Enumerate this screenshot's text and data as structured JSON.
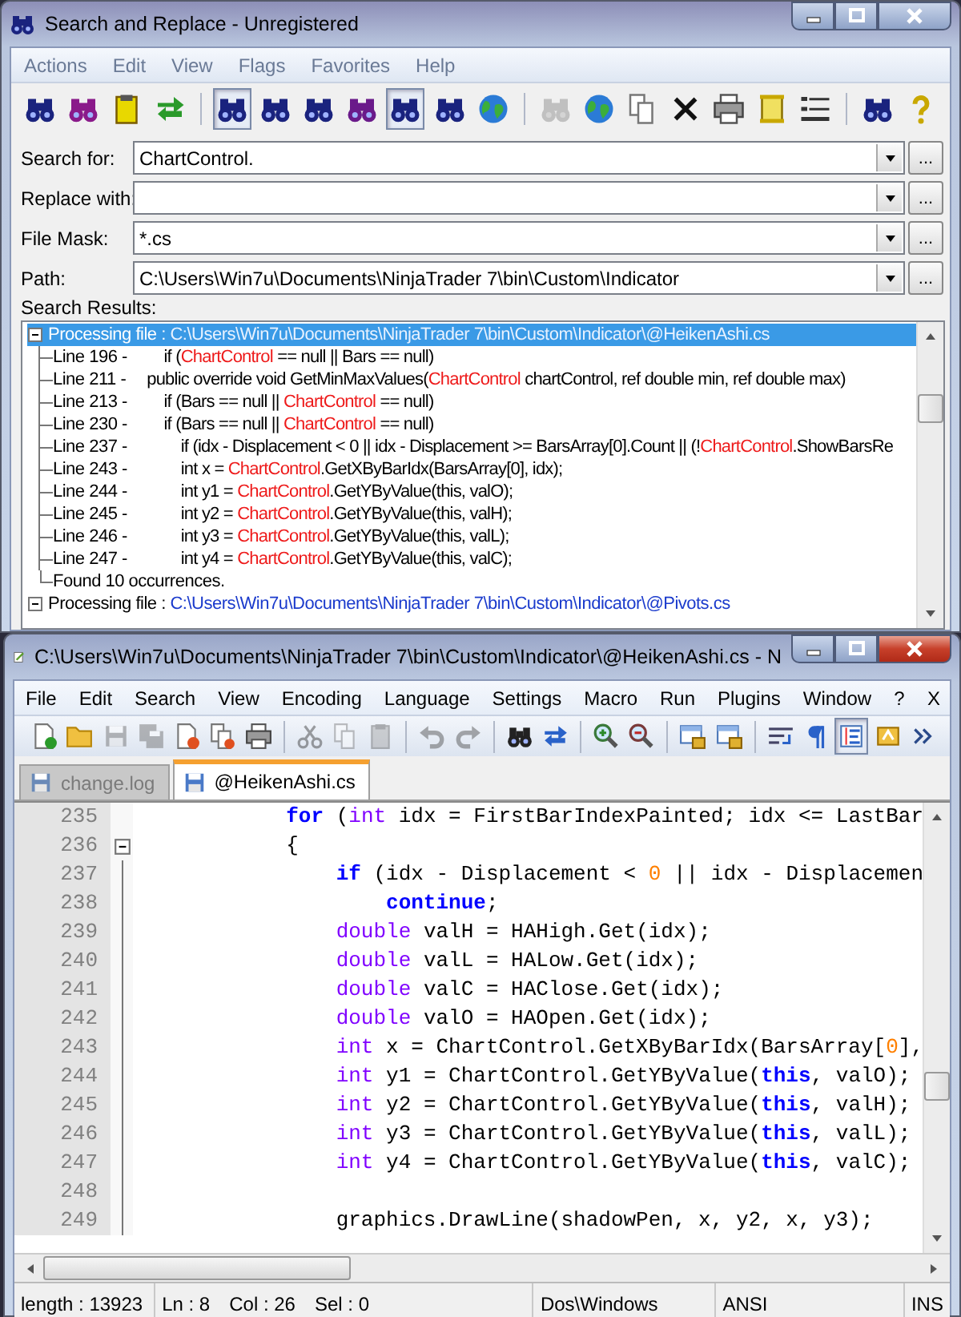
{
  "search_window": {
    "title": "Search and Replace - Unregistered",
    "menu": [
      "Actions",
      "Edit",
      "View",
      "Flags",
      "Favorites",
      "Help"
    ],
    "toolbar": [
      {
        "kind": "button",
        "pressed": false,
        "disabled": false
      },
      {
        "kind": "button",
        "pressed": false,
        "disabled": false
      },
      {
        "kind": "button",
        "pressed": false,
        "disabled": false
      },
      {
        "kind": "button",
        "pressed": false,
        "disabled": false
      },
      {
        "kind": "separator"
      },
      {
        "kind": "button",
        "pressed": true,
        "disabled": false
      },
      {
        "kind": "button",
        "pressed": false,
        "disabled": false
      },
      {
        "kind": "button",
        "pressed": false,
        "disabled": false
      },
      {
        "kind": "button",
        "pressed": false,
        "disabled": false
      },
      {
        "kind": "button",
        "pressed": true,
        "disabled": false
      },
      {
        "kind": "button",
        "pressed": false,
        "disabled": false
      },
      {
        "kind": "button",
        "pressed": false,
        "disabled": false
      },
      {
        "kind": "separator"
      },
      {
        "kind": "button",
        "pressed": false,
        "disabled": true
      },
      {
        "kind": "button",
        "pressed": false,
        "disabled": false
      },
      {
        "kind": "button",
        "pressed": false,
        "disabled": false
      },
      {
        "kind": "button",
        "pressed": false,
        "disabled": false
      },
      {
        "kind": "button",
        "pressed": false,
        "disabled": false
      },
      {
        "kind": "button",
        "pressed": false,
        "disabled": false
      },
      {
        "kind": "button",
        "pressed": false,
        "disabled": false
      },
      {
        "kind": "separator"
      },
      {
        "kind": "button",
        "pressed": false,
        "disabled": false
      },
      {
        "kind": "button",
        "pressed": false,
        "disabled": false
      }
    ],
    "fields": [
      {
        "label": "Search for:",
        "value": "ChartControl.",
        "browse": "..."
      },
      {
        "label": "Replace with:",
        "browse": "..."
      },
      {
        "label": "File Mask:",
        "value": "*.cs",
        "browse": "..."
      },
      {
        "label": "Path:",
        "value": "C:\\Users\\Win7u\\Documents\\NinjaTrader 7\\bin\\Custom\\Indicator",
        "browse": "..."
      }
    ],
    "results_label": "Search Results:",
    "results": [
      {
        "label": "Processing file :",
        "path": "C:\\Users\\Win7u\\Documents\\NinjaTrader 7\\bin\\Custom\\Indicator\\@HeikenAshi.cs",
        "selected": true,
        "expanded": true,
        "children": [
          {
            "line": "Line 196 -",
            "parts": [
              {
                "text": "        if (",
                "match": false
              },
              {
                "text": "ChartControl",
                "match": true
              },
              {
                "text": " == null || Bars == null)",
                "match": false
              }
            ]
          },
          {
            "line": "Line 211 -",
            "parts": [
              {
                "text": "    public override void GetMinMaxValues(",
                "match": false
              },
              {
                "text": "ChartControl",
                "match": true
              },
              {
                "text": " chartControl, ref double min, ref double max)",
                "match": false
              }
            ]
          },
          {
            "line": "Line 213 -",
            "parts": [
              {
                "text": "        if (Bars == null || ",
                "match": false
              },
              {
                "text": "ChartControl",
                "match": true
              },
              {
                "text": " == null)",
                "match": false
              }
            ]
          },
          {
            "line": "Line 230 -",
            "parts": [
              {
                "text": "        if (Bars == null || ",
                "match": false
              },
              {
                "text": "ChartControl",
                "match": true
              },
              {
                "text": " == null)",
                "match": false
              }
            ]
          },
          {
            "line": "Line 237 -",
            "parts": [
              {
                "text": "            if (idx - Displacement < 0 || idx - Displacement >= BarsArray[0].Count || (!",
                "match": false
              },
              {
                "text": "ChartControl",
                "match": true
              },
              {
                "text": ".ShowBarsRe",
                "match": false
              }
            ]
          },
          {
            "line": "Line 243 -",
            "parts": [
              {
                "text": "            int x = ",
                "match": false
              },
              {
                "text": "ChartControl",
                "match": true
              },
              {
                "text": ".GetXByBarIdx(BarsArray[0], idx);",
                "match": false
              }
            ]
          },
          {
            "line": "Line 244 -",
            "parts": [
              {
                "text": "            int y1 = ",
                "match": false
              },
              {
                "text": "ChartControl",
                "match": true
              },
              {
                "text": ".GetYByValue(this, valO);",
                "match": false
              }
            ]
          },
          {
            "line": "Line 245 -",
            "parts": [
              {
                "text": "            int y2 = ",
                "match": false
              },
              {
                "text": "ChartControl",
                "match": true
              },
              {
                "text": ".GetYByValue(this, valH);",
                "match": false
              }
            ]
          },
          {
            "line": "Line 246 -",
            "parts": [
              {
                "text": "            int y3 = ",
                "match": false
              },
              {
                "text": "ChartControl",
                "match": true
              },
              {
                "text": ".GetYByValue(this, valL);",
                "match": false
              }
            ]
          },
          {
            "line": "Line 247 -",
            "parts": [
              {
                "text": "            int y4 = ",
                "match": false
              },
              {
                "text": "ChartControl",
                "match": true
              },
              {
                "text": ".GetYByValue(this, valC);",
                "match": false
              }
            ]
          }
        ],
        "summary": "Found 10 occurrences."
      },
      {
        "label": "Processing file :",
        "path": "C:\\Users\\Win7u\\Documents\\NinjaTrader 7\\bin\\Custom\\Indicator\\@Pivots.cs",
        "selected": false,
        "expanded": true
      }
    ]
  },
  "editor_window": {
    "title": "C:\\Users\\Win7u\\Documents\\NinjaTrader 7\\bin\\Custom\\Indicator\\@HeikenAshi.cs - N",
    "menu": [
      "File",
      "Edit",
      "Search",
      "View",
      "Encoding",
      "Language",
      "Settings",
      "Macro",
      "Run",
      "Plugins",
      "Window",
      "?"
    ],
    "close_doc": "X",
    "toolbar": [
      {
        "kind": "button",
        "pressed": false,
        "disabled": false
      },
      {
        "kind": "button",
        "pressed": false,
        "disabled": false
      },
      {
        "kind": "button",
        "pressed": false,
        "disabled": true
      },
      {
        "kind": "button",
        "pressed": false,
        "disabled": true
      },
      {
        "kind": "button",
        "pressed": false,
        "disabled": false
      },
      {
        "kind": "button",
        "pressed": false,
        "disabled": false
      },
      {
        "kind": "button",
        "pressed": false,
        "disabled": false
      },
      {
        "kind": "separator"
      },
      {
        "kind": "button",
        "pressed": false,
        "disabled": true
      },
      {
        "kind": "button",
        "pressed": false,
        "disabled": true
      },
      {
        "kind": "button",
        "pressed": false,
        "disabled": true
      },
      {
        "kind": "separator"
      },
      {
        "kind": "button",
        "pressed": false,
        "disabled": true
      },
      {
        "kind": "button",
        "pressed": false,
        "disabled": true
      },
      {
        "kind": "separator"
      },
      {
        "kind": "button",
        "pressed": false,
        "disabled": false
      },
      {
        "kind": "button",
        "pressed": false,
        "disabled": false
      },
      {
        "kind": "separator"
      },
      {
        "kind": "button",
        "pressed": false,
        "disabled": false
      },
      {
        "kind": "button",
        "pressed": false,
        "disabled": false
      },
      {
        "kind": "separator"
      },
      {
        "kind": "button",
        "pressed": false,
        "disabled": false
      },
      {
        "kind": "button",
        "pressed": false,
        "disabled": false
      },
      {
        "kind": "separator"
      },
      {
        "kind": "button",
        "pressed": false,
        "disabled": false
      },
      {
        "kind": "button",
        "pressed": false,
        "disabled": false
      },
      {
        "kind": "button",
        "pressed": true,
        "disabled": false
      },
      {
        "kind": "button",
        "pressed": false,
        "disabled": false
      },
      {
        "kind": "button",
        "pressed": false,
        "disabled": false
      }
    ],
    "tabs": [
      {
        "label": "change.log",
        "selected": false
      },
      {
        "label": "@HeikenAshi.cs",
        "selected": true
      }
    ],
    "lines": [
      {
        "number": "235",
        "fold_start": false,
        "tokens": [
          {
            "kind": "keyword",
            "text": "            for"
          },
          {
            "kind": "plain",
            "text": " ("
          },
          {
            "kind": "type",
            "text": "int"
          },
          {
            "kind": "plain",
            "text": " idx = FirstBarIndexPainted; idx <= LastBar"
          }
        ]
      },
      {
        "number": "236",
        "fold_start": true,
        "tokens": [
          {
            "kind": "plain",
            "text": "            {"
          }
        ]
      },
      {
        "number": "237",
        "fold_start": false,
        "tokens": [
          {
            "kind": "keyword",
            "text": "                if"
          },
          {
            "kind": "plain",
            "text": " (idx - Displacement < "
          },
          {
            "kind": "number",
            "text": "0"
          },
          {
            "kind": "plain",
            "text": " || idx - Displacemen"
          }
        ]
      },
      {
        "number": "238",
        "fold_start": false,
        "tokens": [
          {
            "kind": "keyword",
            "text": "                    continue"
          },
          {
            "kind": "plain",
            "text": ";"
          }
        ]
      },
      {
        "number": "239",
        "fold_start": false,
        "tokens": [
          {
            "kind": "type",
            "text": "                double"
          },
          {
            "kind": "plain",
            "text": " valH = HAHigh.Get(idx);"
          }
        ]
      },
      {
        "number": "240",
        "fold_start": false,
        "tokens": [
          {
            "kind": "type",
            "text": "                double"
          },
          {
            "kind": "plain",
            "text": " valL = HALow.Get(idx);"
          }
        ]
      },
      {
        "number": "241",
        "fold_start": false,
        "tokens": [
          {
            "kind": "type",
            "text": "                double"
          },
          {
            "kind": "plain",
            "text": " valC = HAClose.Get(idx);"
          }
        ]
      },
      {
        "number": "242",
        "fold_start": false,
        "tokens": [
          {
            "kind": "type",
            "text": "                double"
          },
          {
            "kind": "plain",
            "text": " valO = HAOpen.Get(idx);"
          }
        ]
      },
      {
        "number": "243",
        "fold_start": false,
        "tokens": [
          {
            "kind": "type",
            "text": "                int"
          },
          {
            "kind": "plain",
            "text": " x = ChartControl.GetXByBarIdx(BarsArray["
          },
          {
            "kind": "number",
            "text": "0"
          },
          {
            "kind": "plain",
            "text": "],"
          }
        ]
      },
      {
        "number": "244",
        "fold_start": false,
        "tokens": [
          {
            "kind": "type",
            "text": "                int"
          },
          {
            "kind": "plain",
            "text": " y1 = ChartControl.GetYByValue("
          },
          {
            "kind": "keyword",
            "text": "this"
          },
          {
            "kind": "plain",
            "text": ", valO);"
          }
        ]
      },
      {
        "number": "245",
        "fold_start": false,
        "tokens": [
          {
            "kind": "type",
            "text": "                int"
          },
          {
            "kind": "plain",
            "text": " y2 = ChartControl.GetYByValue("
          },
          {
            "kind": "keyword",
            "text": "this"
          },
          {
            "kind": "plain",
            "text": ", valH);"
          }
        ]
      },
      {
        "number": "246",
        "fold_start": false,
        "tokens": [
          {
            "kind": "type",
            "text": "                int"
          },
          {
            "kind": "plain",
            "text": " y3 = ChartControl.GetYByValue("
          },
          {
            "kind": "keyword",
            "text": "this"
          },
          {
            "kind": "plain",
            "text": ", valL);"
          }
        ]
      },
      {
        "number": "247",
        "fold_start": false,
        "tokens": [
          {
            "kind": "type",
            "text": "                int"
          },
          {
            "kind": "plain",
            "text": " y4 = ChartControl.GetYByValue("
          },
          {
            "kind": "keyword",
            "text": "this"
          },
          {
            "kind": "plain",
            "text": ", valC);"
          }
        ]
      },
      {
        "number": "248",
        "fold_start": false
      },
      {
        "number": "249",
        "fold_start": false,
        "tokens": [
          {
            "kind": "plain",
            "text": "                graphics.DrawLine(shadowPen, x, y2, x, y3);"
          }
        ]
      }
    ],
    "status": [
      {
        "items": [
          "length : 13923"
        ]
      },
      {
        "items": [
          "Ln : 8",
          "Col : 26",
          "Sel : 0"
        ]
      },
      {
        "items": [
          "Dos\\Windows"
        ]
      },
      {
        "items": [
          "ANSI"
        ]
      },
      {
        "items": [
          "INS"
        ]
      }
    ]
  }
}
